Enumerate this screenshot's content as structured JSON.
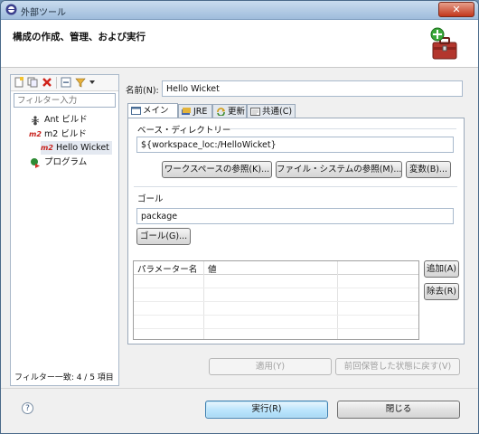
{
  "window": {
    "title": "外部ツール",
    "close_glyph": "✕"
  },
  "banner": {
    "heading": "構成の作成、管理、および実行",
    "icon": "toolbox-add-icon"
  },
  "left_pane": {
    "toolbar_icons": [
      "new-config-icon",
      "duplicate-icon",
      "delete-icon",
      "collapse-all-icon",
      "filter-icon",
      "dropdown-arrow-icon"
    ],
    "filter_placeholder": "フィルター入力",
    "tree": [
      {
        "label": "Ant ビルド",
        "icon": "ant-icon",
        "level": 0
      },
      {
        "label": "m2 ビルド",
        "icon": "m2-icon",
        "badge": "m2",
        "level": 0
      },
      {
        "label": "Hello Wicket",
        "icon": "m2-icon",
        "badge": "m2",
        "level": 1,
        "selected": true
      },
      {
        "label": "プログラム",
        "icon": "program-icon",
        "level": 0
      }
    ],
    "status": "フィルター一致: 4 / 5 項目"
  },
  "form": {
    "name_label": "名前(N):",
    "name_value": "Hello Wicket",
    "tabs": [
      {
        "label": "メイン",
        "icon": "main-tab-icon",
        "active": true
      },
      {
        "label": "JRE",
        "icon": "jre-icon"
      },
      {
        "label": "更新",
        "icon": "refresh-icon"
      },
      {
        "label": "共通(C)",
        "icon": "common-icon"
      }
    ],
    "base_dir": {
      "title": "ベース・ディレクトリー",
      "value": "${workspace_loc:/HelloWicket}",
      "btn_workspace": "ワークスペースの参照(K)...",
      "btn_filesystem": "ファイル・システムの参照(M)...",
      "btn_variables": "変数(B)..."
    },
    "goal": {
      "title": "ゴール",
      "value": "package",
      "btn_goal": "ゴール(G)..."
    },
    "params": {
      "columns": [
        "パラメーター名",
        "値"
      ],
      "btn_add": "追加(A)",
      "btn_remove": "除去(R)"
    },
    "btn_apply": "適用(Y)",
    "btn_revert": "前回保管した状態に戻す(V)"
  },
  "footer": {
    "help_glyph": "?",
    "btn_run": "実行(R)",
    "btn_close": "閉じる"
  }
}
